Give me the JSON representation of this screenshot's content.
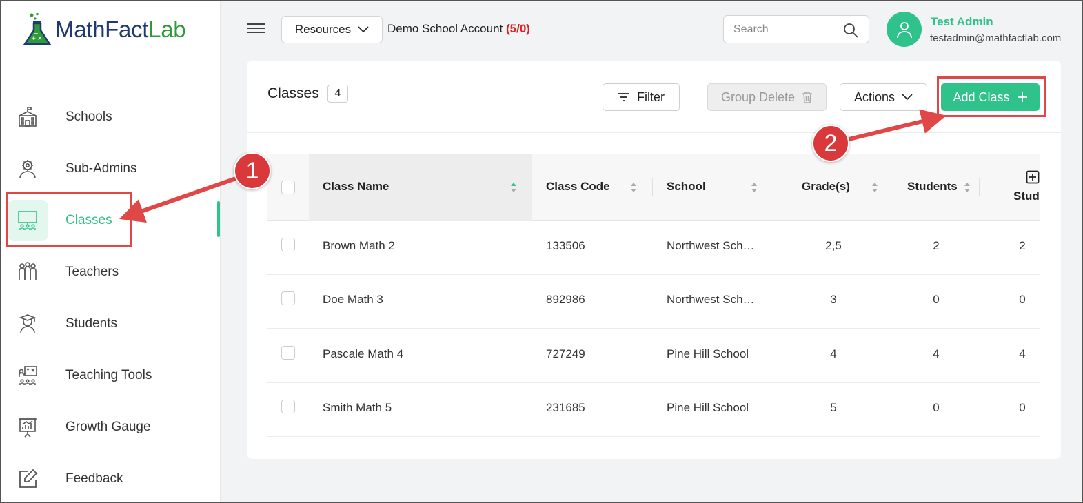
{
  "brand": {
    "name_part1": "MathFact",
    "name_part2": "Lab",
    "accent": "#2fc28a",
    "logo_blue": "#1f3a73",
    "logo_green": "#2f9a3a"
  },
  "header": {
    "resources_label": "Resources",
    "account_name": "Demo School Account",
    "account_count": "(5/0)",
    "search_placeholder": "Search",
    "user_name": "Test Admin",
    "user_email": "testadmin@mathfactlab.com"
  },
  "sidebar": {
    "items": [
      {
        "label": "Schools",
        "icon": "school-icon"
      },
      {
        "label": "Sub-Admins",
        "icon": "sub-admin-icon"
      },
      {
        "label": "Classes",
        "icon": "classroom-icon",
        "active": true
      },
      {
        "label": "Teachers",
        "icon": "teachers-icon"
      },
      {
        "label": "Students",
        "icon": "student-icon"
      },
      {
        "label": "Teaching Tools",
        "icon": "teaching-tools-icon"
      },
      {
        "label": "Growth Gauge",
        "icon": "growth-chart-icon"
      },
      {
        "label": "Feedback",
        "icon": "edit-icon"
      }
    ]
  },
  "classes": {
    "title": "Classes",
    "count": "4",
    "filter_label": "Filter",
    "group_delete_label": "Group Delete",
    "actions_label": "Actions",
    "add_class_label": "Add Class",
    "columns": [
      "Class Name",
      "Class Code",
      "School",
      "Grade(s)",
      "Students",
      "Stud"
    ],
    "rows": [
      {
        "name": "Brown Math 2",
        "code": "133506",
        "school": "Northwest Sch…",
        "grades": "2,5",
        "students": "2",
        "stud": "2"
      },
      {
        "name": "Doe Math 3",
        "code": "892986",
        "school": "Northwest Sch…",
        "grades": "3",
        "students": "0",
        "stud": "0"
      },
      {
        "name": "Pascale Math 4",
        "code": "727249",
        "school": "Pine Hill School",
        "grades": "4",
        "students": "4",
        "stud": "4"
      },
      {
        "name": "Smith Math 5",
        "code": "231685",
        "school": "Pine Hill School",
        "grades": "5",
        "students": "0",
        "stud": "0"
      }
    ]
  },
  "annotations": {
    "step1": "1",
    "step2": "2",
    "highlight_color": "#e04848"
  }
}
